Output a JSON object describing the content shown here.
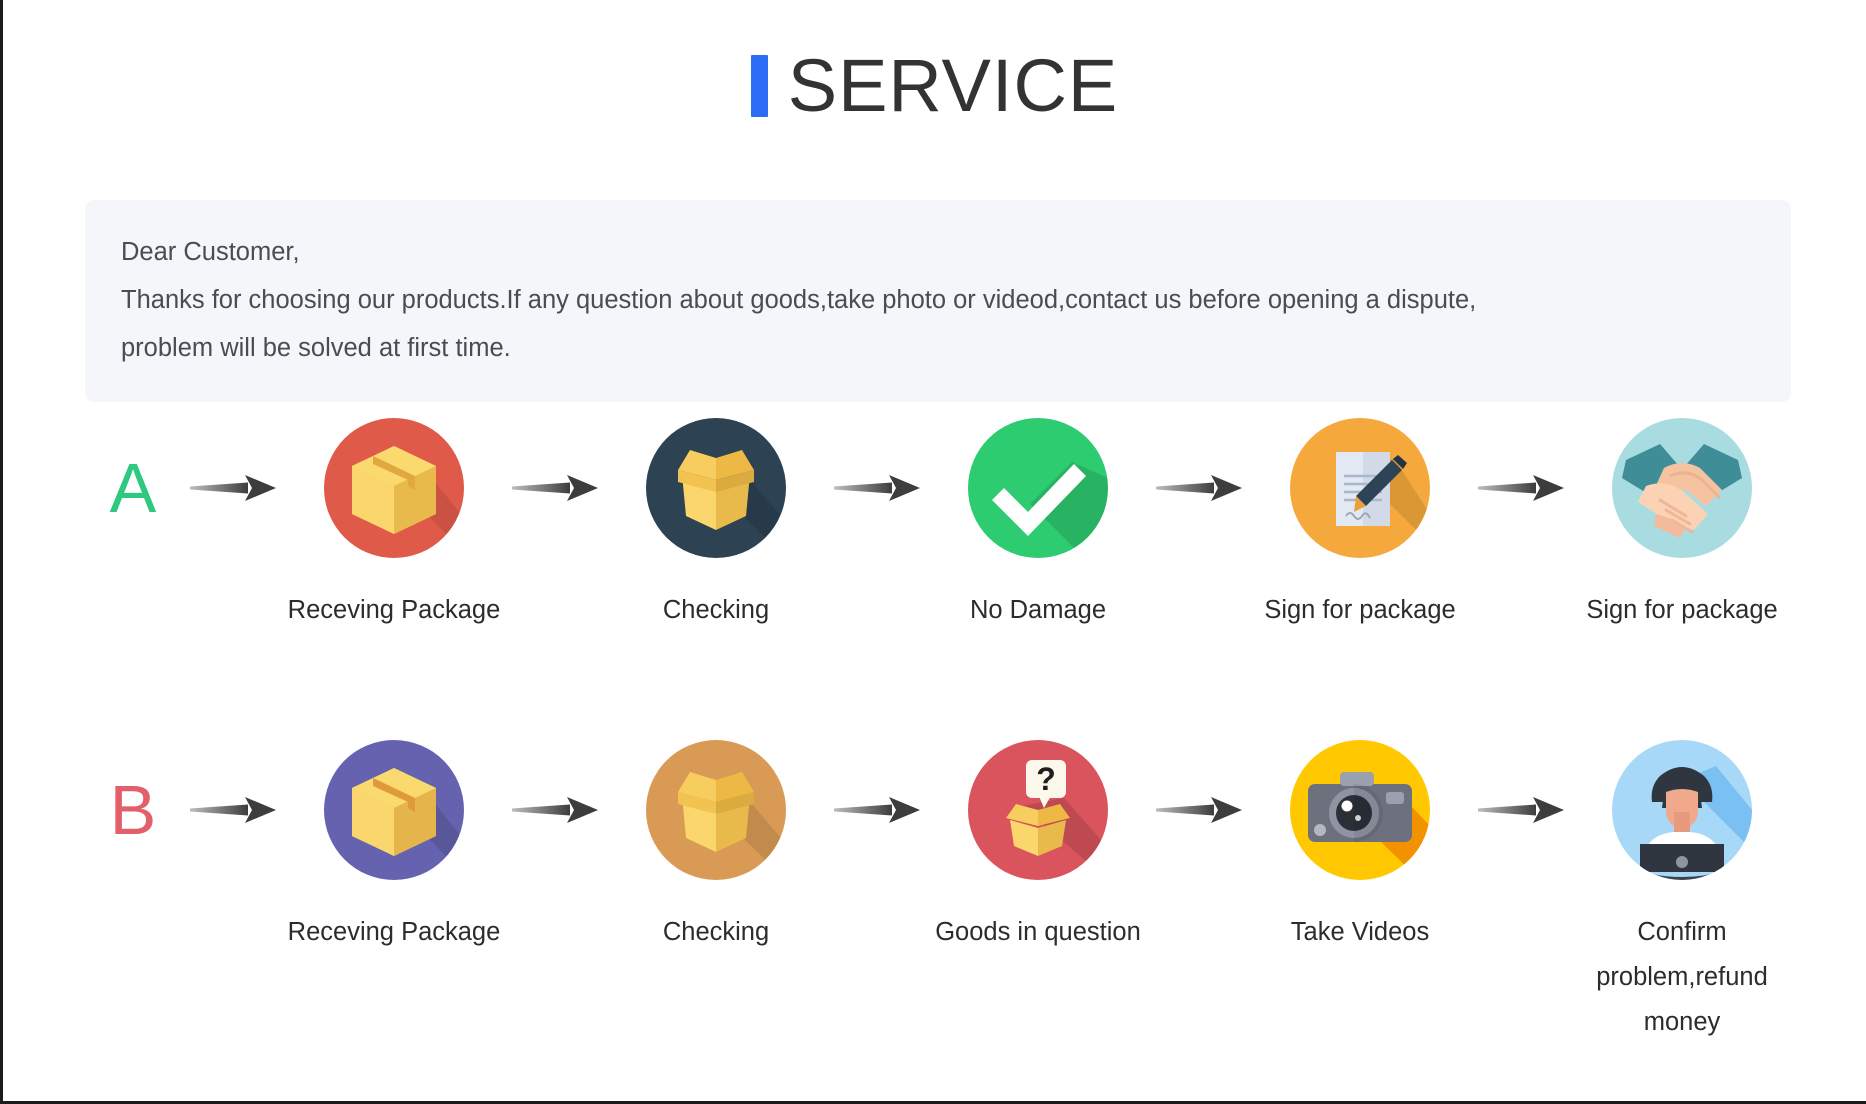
{
  "header": {
    "title": "SERVICE",
    "accent_color": "#2a6df4"
  },
  "notice": {
    "line1": "Dear Customer,",
    "line2": "Thanks for choosing our products.If any question about goods,take photo or videod,contact us before opening a dispute,",
    "line3": "problem will be solved at first time.",
    "background_color": "#f4f6f9"
  },
  "flows": [
    {
      "badge": "A",
      "badge_color": "#2ec97f",
      "steps": [
        {
          "label": "Receving Package",
          "icon": "closed-box-icon",
          "circle_color": "#e05a4a"
        },
        {
          "label": "Checking",
          "icon": "open-box-icon",
          "circle_color": "#2d4354"
        },
        {
          "label": "No Damage",
          "icon": "checkmark-icon",
          "circle_color": "#2ecc71"
        },
        {
          "label": "Sign for package",
          "icon": "document-pen-icon",
          "circle_color": "#f5a93c"
        },
        {
          "label": "Sign for package",
          "icon": "handshake-icon",
          "circle_color": "#a8dce0"
        }
      ]
    },
    {
      "badge": "B",
      "badge_color": "#e2606a",
      "steps": [
        {
          "label": "Receving Package",
          "icon": "closed-box-icon",
          "circle_color": "#6563b0"
        },
        {
          "label": "Checking",
          "icon": "open-box-icon",
          "circle_color": "#d99a55"
        },
        {
          "label": "Goods in question",
          "icon": "question-box-icon",
          "circle_color": "#d9545c"
        },
        {
          "label": "Take Videos",
          "icon": "camera-icon",
          "circle_color": "#ffc800"
        },
        {
          "label": "Confirm problem,refund money",
          "icon": "support-person-icon",
          "circle_color": "#a8d8f8"
        }
      ]
    }
  ],
  "arrow": {
    "name": "arrow-right-icon",
    "color": "#4a4a4a"
  }
}
